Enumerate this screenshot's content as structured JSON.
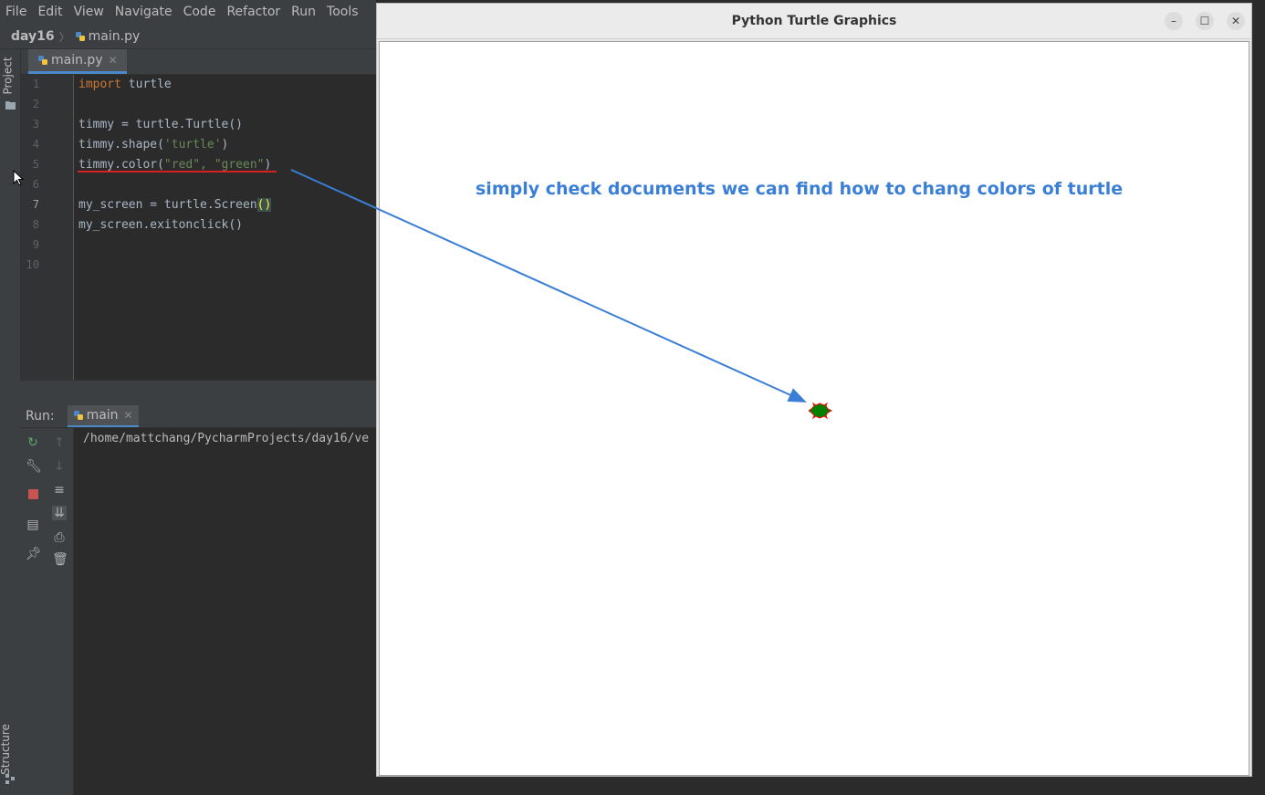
{
  "menu": [
    "File",
    "Edit",
    "View",
    "Navigate",
    "Code",
    "Refactor",
    "Run",
    "Tools"
  ],
  "breadcrumb": {
    "project": "day16",
    "file": "main.py"
  },
  "sidebar": {
    "project": "Project",
    "structure": "Structure"
  },
  "editor": {
    "tab": "main.py",
    "current_line": 7,
    "line_numbers": [
      "1",
      "2",
      "3",
      "4",
      "5",
      "6",
      "7",
      "8",
      "9",
      "10"
    ],
    "lines": [
      {
        "kw": "import",
        "rest": " turtle"
      },
      {
        "text": ""
      },
      {
        "text": "timmy = turtle.Turtle()"
      },
      {
        "pre": "timmy.shape(",
        "str": "'turtle'",
        "post": ")"
      },
      {
        "pre": "timmy.color(",
        "str": "\"red\", \"green\"",
        "post": ")"
      },
      {
        "text": ""
      },
      {
        "pre": "my_screen = turtle.Screen",
        "paren": "()"
      },
      {
        "text": "my_screen.exitonclick()"
      },
      {
        "text": ""
      },
      {
        "text": ""
      }
    ]
  },
  "run": {
    "label": "Run:",
    "tab": "main",
    "output": "/home/mattchang/PycharmProjects/day16/ve"
  },
  "turtle_window": {
    "title": "Python Turtle Graphics",
    "annotation": "simply check documents we can find how to chang colors of turtle"
  },
  "colors": {
    "annotation": "#3a7fd5",
    "turtle_fill": "#008000",
    "turtle_outline": "#ff0000"
  }
}
